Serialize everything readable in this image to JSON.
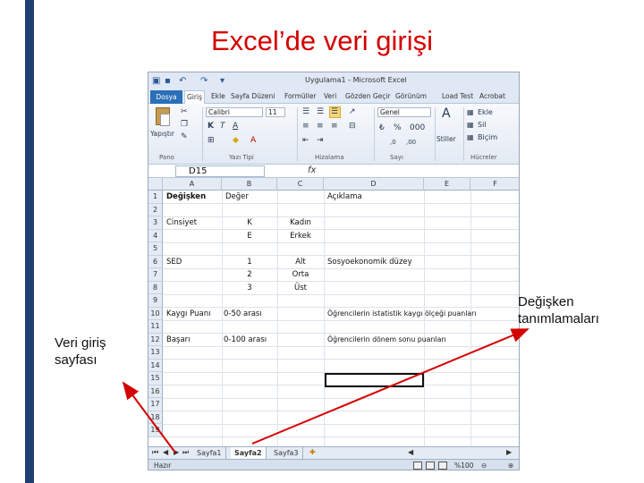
{
  "slide": {
    "title": "Excel’de veri girişi",
    "callout_right_line1": "Değişken",
    "callout_right_line2": "tanımlamaları",
    "callout_left_line1": "Veri giriş",
    "callout_left_line2": "sayfası"
  },
  "excel": {
    "app_title": "Uygulama1 - Microsoft Excel",
    "tabs": [
      "Dosya",
      "Giriş",
      "Ekle",
      "Sayfa Düzeni",
      "Formüller",
      "Veri",
      "Gözden Geçir",
      "Görünüm",
      "Load Test",
      "Acrobat"
    ],
    "ribbon": {
      "paste_label": "Yapıştır",
      "font_name": "Calibri",
      "font_size": "11",
      "number_format": "Genel",
      "styles_label": "Stiller",
      "insert_label": "Ekle",
      "delete_label": "Sil",
      "format_label": "Biçim",
      "groups": [
        "Pano",
        "Yazı Tipi",
        "Hizalama",
        "Sayı",
        "Hücreler"
      ]
    },
    "name_box": "D15",
    "fx_label": "fx",
    "columns": [
      "A",
      "B",
      "C",
      "D",
      "E",
      "F"
    ],
    "rows": [
      "1",
      "2",
      "3",
      "4",
      "5",
      "6",
      "7",
      "8",
      "9",
      "10",
      "11",
      "12",
      "13",
      "14",
      "15",
      "16",
      "17",
      "18",
      "19"
    ],
    "cells": {
      "a1": "Değişken",
      "b1": "Değer",
      "d1": "Açıklama",
      "a3": "Cinsiyet",
      "b3": "K",
      "c3": "Kadın",
      "b4": "E",
      "c4": "Erkek",
      "a6": "SED",
      "b6": "1",
      "c6": "Alt",
      "d6": "Sosyoekonomik düzey",
      "b7": "2",
      "c7": "Orta",
      "b8": "3",
      "c8": "Üst",
      "a10": "Kaygı Puanı",
      "b10": "0-50 arası",
      "d10": "Öğrencilerin istatistik kaygı ölçeği puanları",
      "a12": "Başarı",
      "b12": "0-100 arası",
      "d12": "Öğrencilerin dönem sonu puanları"
    },
    "sheets": [
      "Sayfa1",
      "Sayfa2",
      "Sayfa3"
    ],
    "active_sheet": "Sayfa2",
    "status": "Hazır",
    "zoom": "%100"
  }
}
